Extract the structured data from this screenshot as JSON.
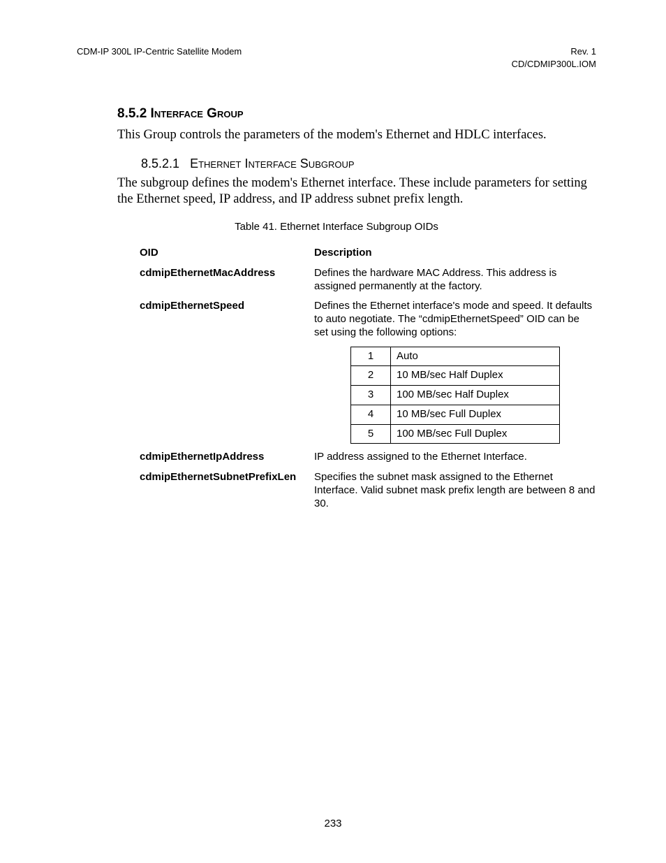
{
  "header": {
    "left": "CDM-IP 300L IP-Centric Satellite Modem",
    "right_line1": "Rev. 1",
    "right_line2": "CD/CDMIP300L.IOM"
  },
  "sections": {
    "s852": {
      "number": "8.5.2",
      "title": "Interface Group",
      "body": "This Group controls the parameters of the modem's Ethernet and HDLC interfaces."
    },
    "s8521": {
      "number": "8.5.2.1",
      "title": "Ethernet Interface Subgroup",
      "body": "The subgroup defines the modem's Ethernet interface.  These include parameters for setting the Ethernet speed, IP address, and IP address subnet prefix length."
    }
  },
  "table": {
    "caption": "Table 41. Ethernet Interface Subgroup OIDs",
    "head_oid": "OID",
    "head_desc": "Description",
    "rows": [
      {
        "oid": "cdmipEthernetMacAddress",
        "desc": "Defines the hardware MAC Address. This address is assigned permanently at the factory."
      },
      {
        "oid": "cdmipEthernetSpeed",
        "desc": "Defines the Ethernet interface's mode and speed. It defaults to auto negotiate. The “cdmipEthernetSpeed” OID can be set using the following options:",
        "options": [
          {
            "n": "1",
            "label": "Auto"
          },
          {
            "n": "2",
            "label": "10 MB/sec Half Duplex"
          },
          {
            "n": "3",
            "label": "100 MB/sec Half Duplex"
          },
          {
            "n": "4",
            "label": "10 MB/sec Full Duplex"
          },
          {
            "n": "5",
            "label": "100 MB/sec Full Duplex"
          }
        ]
      },
      {
        "oid": "cdmipEthernetIpAddress",
        "desc": "IP address assigned to the Ethernet Interface."
      },
      {
        "oid": "cdmipEthernetSubnetPrefixLen",
        "desc": "Specifies the subnet mask assigned to the Ethernet Interface. Valid subnet mask prefix length are between 8 and 30."
      }
    ]
  },
  "page_number": "233"
}
